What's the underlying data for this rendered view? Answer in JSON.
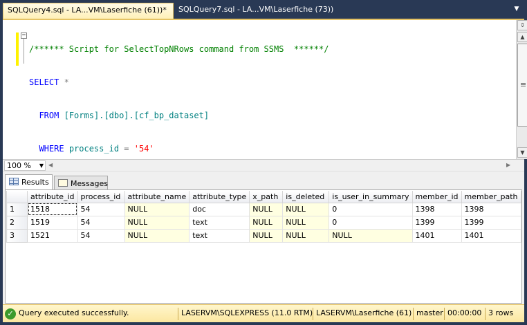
{
  "tabs": [
    {
      "label": "SQLQuery4.sql - LA...VM\\Laserfiche (61))*",
      "active": true
    },
    {
      "label": "SQLQuery7.sql - LA...VM\\Laserfiche (73))",
      "active": false
    }
  ],
  "editor": {
    "line1": {
      "comment": "/****** Script for SelectTopNRows command from SSMS  ******/"
    },
    "line2": {
      "kw": "SELECT",
      "rest": " *"
    },
    "line3": {
      "kw": "FROM",
      "from_obj": "[Forms].[dbo].[cf_bp_dataset]"
    },
    "line4": {
      "kw": "WHERE",
      "col": "process_id",
      "op": "=",
      "str": "'54'"
    }
  },
  "zoom": {
    "value": "100 %"
  },
  "results_tabs": [
    {
      "label": "Results",
      "icon": "grid-icon"
    },
    {
      "label": "Messages",
      "icon": "messages-icon"
    }
  ],
  "grid": {
    "columns": [
      "attribute_id",
      "process_id",
      "attribute_name",
      "attribute_type",
      "x_path",
      "is_deleted",
      "is_user_in_summary",
      "member_id",
      "member_path"
    ],
    "rows": [
      {
        "n": "1",
        "cells": [
          "1518",
          "54",
          "NULL",
          "doc",
          "NULL",
          "NULL",
          "0",
          "1398",
          "1398"
        ]
      },
      {
        "n": "2",
        "cells": [
          "1519",
          "54",
          "NULL",
          "text",
          "NULL",
          "NULL",
          "0",
          "1399",
          "1399"
        ]
      },
      {
        "n": "3",
        "cells": [
          "1521",
          "54",
          "NULL",
          "text",
          "NULL",
          "NULL",
          "NULL",
          "1401",
          "1401"
        ]
      }
    ]
  },
  "status": {
    "message": "Query executed successfully.",
    "server": "LASERVM\\SQLEXPRESS (11.0 RTM)",
    "login": "LASERVM\\Laserfiche (61)",
    "database": "master",
    "elapsed": "00:00:00",
    "rows": "3 rows"
  },
  "colors": {
    "accent": "#e5c365",
    "background": "#293955",
    "null_cell": "#ffffe1",
    "success": "#3c9a2c"
  }
}
